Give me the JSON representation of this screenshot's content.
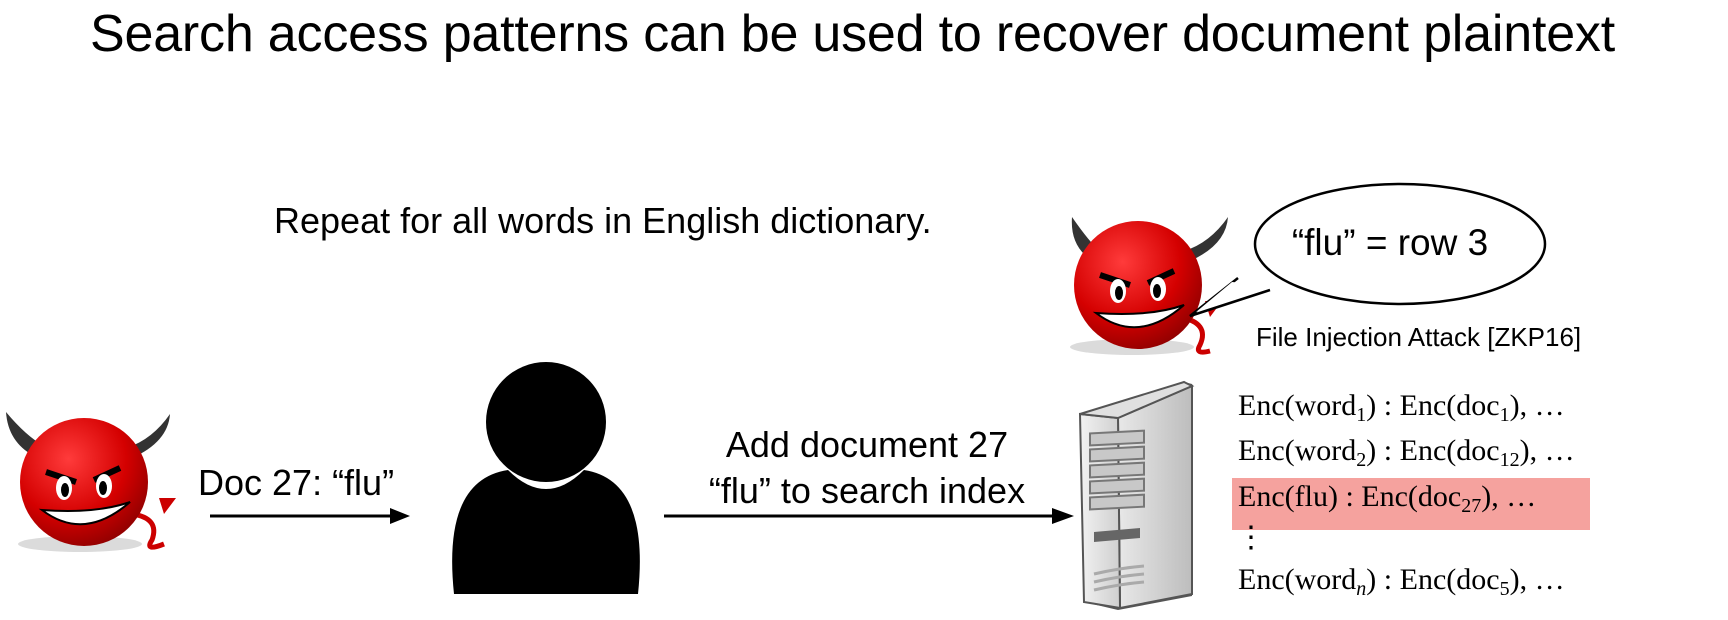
{
  "title": "Search access patterns can be used to recover document plaintext",
  "repeat_note": "Repeat for all words in English dictionary.",
  "doc_label": "Doc 27: “flu”",
  "add_line1": "Add document 27",
  "add_line2": "“flu” to search index",
  "bubble_text": "“flu” = row 3",
  "attack_label": "File Injection Attack [ZKP16]",
  "index_rows": [
    {
      "pre": "Enc(word",
      "sub1": "1",
      "mid": ") : Enc(doc",
      "sub2": "1",
      "post": "), …"
    },
    {
      "pre": "Enc(word",
      "sub1": "2",
      "mid": ") : Enc(doc",
      "sub2": "12",
      "post": "), …"
    },
    {
      "pre": "Enc(flu) : Enc(doc",
      "sub2": "27",
      "post": "), …"
    },
    {
      "dots": "⋮"
    },
    {
      "pre": "Enc(word",
      "sub1": "n",
      "mid": ") : Enc(doc",
      "sub2": "5",
      "post": "), …"
    }
  ],
  "colors": {
    "devil_red": "#d40000",
    "highlight": "#f5a29e",
    "user_black": "#000000",
    "server_gray": "#d6d6d6"
  },
  "icons": [
    "devil-icon",
    "user-icon",
    "server-icon",
    "speech-bubble-icon"
  ]
}
